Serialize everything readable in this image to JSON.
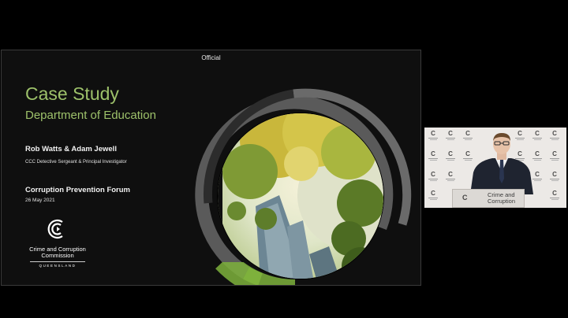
{
  "slide": {
    "header_label": "Official",
    "title": "Case Study",
    "subtitle": "Department of Education",
    "presenters": "Rob Watts & Adam Jewell",
    "roles": "CCC Detective Sergeant  & Principal Investigator",
    "event": "Corruption Prevention Forum",
    "date": "26 May 2021",
    "logo": {
      "line1": "Crime and Corruption",
      "line2": "Commission",
      "line3": "QUEENSLAND"
    },
    "accent_color": "#9dc16a",
    "graphic": "ring-with-tree-canopy-photo"
  },
  "video_feed": {
    "podium_sign": {
      "line1": "Crime and",
      "line2": "Corruption"
    }
  }
}
